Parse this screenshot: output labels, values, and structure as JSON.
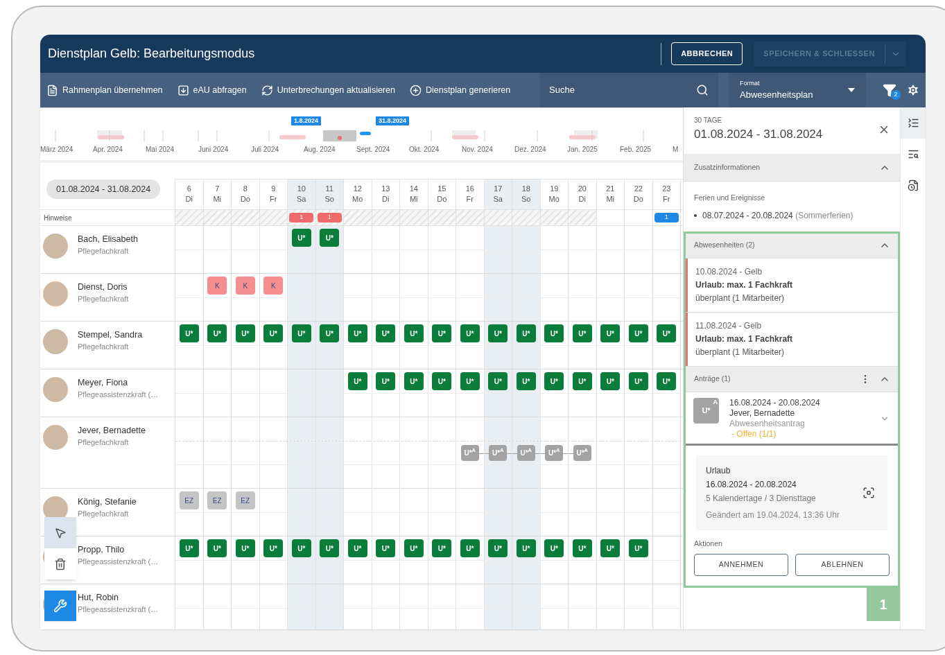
{
  "window": {
    "title": "Dienstplan Gelb: Bearbeitungsmodus"
  },
  "header_buttons": [
    {
      "label": "ABBRECHEN",
      "disabled": false
    },
    {
      "label": "SPEICHERN & SCHLIESSEN",
      "disabled": true
    }
  ],
  "toolbar": {
    "actions": [
      {
        "label": "Rahmenplan übernehmen",
        "kind": "template"
      },
      {
        "label": "eAU abfragen",
        "kind": "download"
      },
      {
        "label": "Unterbrechungen aktualisieren",
        "kind": "refresh"
      },
      {
        "label": "Dienstplan generieren",
        "kind": "generate"
      }
    ],
    "search": {
      "placeholder": "Suche"
    },
    "format": {
      "label": "Format",
      "value": "Abwesenheitsplan"
    },
    "filter_badge": "2"
  },
  "timeline": {
    "months": [
      "März 2024",
      "Apr. 2024",
      "Mai 2024",
      "Juni 2024",
      "Juli 2024",
      "Aug. 2024",
      "Sept. 2024",
      "Okt. 2024",
      "Nov. 2024",
      "Dez. 2024",
      "Jan. 2025",
      "Feb. 2025",
      "M"
    ],
    "range_start": "1.8.2024",
    "range_end": "31.8.2024"
  },
  "grid": {
    "range": "01.08.2024 - 31.08.2024",
    "hints_label": "Hinweise",
    "days": [
      {
        "day": "6",
        "weekday": "Di",
        "weekend": false,
        "holiday": true
      },
      {
        "day": "7",
        "weekday": "Mi",
        "weekend": false,
        "holiday": true
      },
      {
        "day": "8",
        "weekday": "Do",
        "weekend": false,
        "holiday": true
      },
      {
        "day": "9",
        "weekday": "Fr",
        "weekend": false,
        "holiday": true
      },
      {
        "day": "10",
        "weekday": "Sa",
        "weekend": true,
        "holiday": true
      },
      {
        "day": "11",
        "weekday": "So",
        "weekend": true,
        "holiday": true
      },
      {
        "day": "12",
        "weekday": "Mo",
        "weekend": false,
        "holiday": true
      },
      {
        "day": "13",
        "weekday": "Di",
        "weekend": false,
        "holiday": true
      },
      {
        "day": "14",
        "weekday": "Mi",
        "weekend": false,
        "holiday": true
      },
      {
        "day": "15",
        "weekday": "Do",
        "weekend": false,
        "holiday": true
      },
      {
        "day": "16",
        "weekday": "Fr",
        "weekend": false,
        "holiday": true
      },
      {
        "day": "17",
        "weekday": "Sa",
        "weekend": true,
        "holiday": true
      },
      {
        "day": "18",
        "weekday": "So",
        "weekend": true,
        "holiday": true
      },
      {
        "day": "19",
        "weekday": "Mo",
        "weekend": false,
        "holiday": true
      },
      {
        "day": "20",
        "weekday": "Di",
        "weekend": false,
        "holiday": true
      },
      {
        "day": "21",
        "weekday": "Mi",
        "weekend": false,
        "holiday": false
      },
      {
        "day": "22",
        "weekday": "Do",
        "weekend": false,
        "holiday": false
      },
      {
        "day": "23",
        "weekday": "Fr",
        "weekend": false,
        "holiday": false
      }
    ],
    "hints": [
      {
        "kind": "empty"
      },
      {
        "kind": "empty"
      },
      {
        "kind": "empty"
      },
      {
        "kind": "empty"
      },
      {
        "kind": "warning",
        "count": "1"
      },
      {
        "kind": "warning",
        "count": "1"
      },
      {
        "kind": "empty"
      },
      {
        "kind": "empty"
      },
      {
        "kind": "empty"
      },
      {
        "kind": "empty"
      },
      {
        "kind": "empty"
      },
      {
        "kind": "empty"
      },
      {
        "kind": "empty"
      },
      {
        "kind": "empty"
      },
      {
        "kind": "empty"
      },
      {
        "kind": "empty"
      },
      {
        "kind": "empty"
      },
      {
        "kind": "info",
        "count": "1"
      }
    ],
    "employees": [
      {
        "name": "Bach, Elisabeth",
        "role": "Pflegefachkraft",
        "lanes": [
          [
            {
              "kind": "empty"
            },
            {
              "kind": "empty"
            },
            {
              "kind": "empty"
            },
            {
              "kind": "empty"
            },
            {
              "kind": "vacation",
              "code": "U*"
            },
            {
              "kind": "vacation",
              "code": "U*"
            },
            {
              "kind": "empty"
            },
            {
              "kind": "empty"
            },
            {
              "kind": "empty"
            },
            {
              "kind": "empty"
            },
            {
              "kind": "empty"
            },
            {
              "kind": "empty"
            },
            {
              "kind": "empty"
            },
            {
              "kind": "empty"
            },
            {
              "kind": "empty"
            },
            {
              "kind": "empty"
            },
            {
              "kind": "empty"
            },
            {
              "kind": "empty"
            }
          ]
        ]
      },
      {
        "name": "Dienst, Doris",
        "role": "Pflegefachkraft",
        "lanes": [
          [
            {
              "kind": "empty"
            },
            {
              "kind": "sick",
              "code": "K"
            },
            {
              "kind": "sick",
              "code": "K"
            },
            {
              "kind": "sick",
              "code": "K"
            },
            {
              "kind": "empty"
            },
            {
              "kind": "empty"
            },
            {
              "kind": "empty"
            },
            {
              "kind": "empty"
            },
            {
              "kind": "empty"
            },
            {
              "kind": "empty"
            },
            {
              "kind": "empty"
            },
            {
              "kind": "empty"
            },
            {
              "kind": "empty"
            },
            {
              "kind": "empty"
            },
            {
              "kind": "empty"
            },
            {
              "kind": "empty"
            },
            {
              "kind": "empty"
            },
            {
              "kind": "empty"
            }
          ]
        ]
      },
      {
        "name": "Stempel, Sandra",
        "role": "Pflegefachkraft",
        "lanes": [
          [
            {
              "kind": "vacation",
              "code": "U*"
            },
            {
              "kind": "vacation",
              "code": "U*"
            },
            {
              "kind": "vacation",
              "code": "U*"
            },
            {
              "kind": "vacation",
              "code": "U*"
            },
            {
              "kind": "vacation",
              "code": "U*"
            },
            {
              "kind": "vacation",
              "code": "U*"
            },
            {
              "kind": "vacation",
              "code": "U*"
            },
            {
              "kind": "vacation",
              "code": "U*"
            },
            {
              "kind": "vacation",
              "code": "U*"
            },
            {
              "kind": "vacation",
              "code": "U*"
            },
            {
              "kind": "vacation",
              "code": "U*"
            },
            {
              "kind": "vacation",
              "code": "U*"
            },
            {
              "kind": "vacation",
              "code": "U*"
            },
            {
              "kind": "vacation",
              "code": "U*"
            },
            {
              "kind": "vacation",
              "code": "U*"
            },
            {
              "kind": "vacation",
              "code": "U*"
            },
            {
              "kind": "vacation",
              "code": "U*"
            },
            {
              "kind": "vacation",
              "code": "U*"
            }
          ]
        ]
      },
      {
        "name": "Meyer, Fiona",
        "role": "Pflegeassistenzkraft (…",
        "lanes": [
          [
            {
              "kind": "empty"
            },
            {
              "kind": "empty"
            },
            {
              "kind": "empty"
            },
            {
              "kind": "empty"
            },
            {
              "kind": "empty"
            },
            {
              "kind": "empty"
            },
            {
              "kind": "vacation",
              "code": "U*"
            },
            {
              "kind": "vacation",
              "code": "U*"
            },
            {
              "kind": "vacation",
              "code": "U*"
            },
            {
              "kind": "vacation",
              "code": "U*"
            },
            {
              "kind": "vacation",
              "code": "U*"
            },
            {
              "kind": "vacation",
              "code": "U*"
            },
            {
              "kind": "vacation",
              "code": "U*"
            },
            {
              "kind": "vacation",
              "code": "U*"
            },
            {
              "kind": "vacation",
              "code": "U*"
            },
            {
              "kind": "vacation",
              "code": "U*"
            },
            {
              "kind": "vacation",
              "code": "U*"
            },
            {
              "kind": "vacation",
              "code": "U*"
            }
          ]
        ]
      },
      {
        "name": "Jever, Bernadette",
        "role": "Pflegefachkraft",
        "lanes": [
          [
            {
              "kind": "empty"
            },
            {
              "kind": "empty"
            },
            {
              "kind": "empty"
            },
            {
              "kind": "empty"
            },
            {
              "kind": "empty"
            },
            {
              "kind": "empty"
            },
            {
              "kind": "empty"
            },
            {
              "kind": "empty"
            },
            {
              "kind": "empty"
            },
            {
              "kind": "empty"
            },
            {
              "kind": "empty"
            },
            {
              "kind": "empty"
            },
            {
              "kind": "empty"
            },
            {
              "kind": "empty"
            },
            {
              "kind": "empty"
            },
            {
              "kind": "empty"
            },
            {
              "kind": "empty"
            },
            {
              "kind": "empty"
            }
          ],
          [
            {
              "kind": "empty"
            },
            {
              "kind": "empty"
            },
            {
              "kind": "empty"
            },
            {
              "kind": "empty"
            },
            {
              "kind": "empty"
            },
            {
              "kind": "empty"
            },
            {
              "kind": "empty"
            },
            {
              "kind": "empty"
            },
            {
              "kind": "empty"
            },
            {
              "kind": "empty"
            },
            {
              "kind": "request",
              "code": "U*$^{A}$"
            },
            {
              "kind": "request",
              "code": "U*$^{A}$"
            },
            {
              "kind": "request",
              "code": "U*$^{A}$"
            },
            {
              "kind": "request",
              "code": "U*$^{A}$"
            },
            {
              "kind": "request",
              "code": "U*$^{A}$"
            },
            {
              "kind": "empty"
            },
            {
              "kind": "empty"
            },
            {
              "kind": "empty"
            }
          ]
        ]
      },
      {
        "name": "König, Stefanie",
        "role": "Pflegefachkraft",
        "lanes": [
          [
            {
              "kind": "timeoff",
              "code": "EZ"
            },
            {
              "kind": "timeoff",
              "code": "EZ"
            },
            {
              "kind": "timeoff",
              "code": "EZ"
            },
            {
              "kind": "empty"
            },
            {
              "kind": "empty"
            },
            {
              "kind": "empty"
            },
            {
              "kind": "empty"
            },
            {
              "kind": "empty"
            },
            {
              "kind": "empty"
            },
            {
              "kind": "empty"
            },
            {
              "kind": "empty"
            },
            {
              "kind": "empty"
            },
            {
              "kind": "empty"
            },
            {
              "kind": "empty"
            },
            {
              "kind": "empty"
            },
            {
              "kind": "empty"
            },
            {
              "kind": "empty"
            },
            {
              "kind": "empty"
            }
          ]
        ]
      },
      {
        "name": "Propp, Thilo",
        "role": "Pflegeassistenzkraft (…",
        "lanes": [
          [
            {
              "kind": "vacation",
              "code": "U*"
            },
            {
              "kind": "vacation",
              "code": "U*"
            },
            {
              "kind": "vacation",
              "code": "U*"
            },
            {
              "kind": "vacation",
              "code": "U*"
            },
            {
              "kind": "vacation",
              "code": "U*"
            },
            {
              "kind": "vacation",
              "code": "U*"
            },
            {
              "kind": "vacation",
              "code": "U*"
            },
            {
              "kind": "vacation",
              "code": "U*"
            },
            {
              "kind": "vacation",
              "code": "U*"
            },
            {
              "kind": "vacation",
              "code": "U*"
            },
            {
              "kind": "vacation",
              "code": "U*"
            },
            {
              "kind": "vacation",
              "code": "U*"
            },
            {
              "kind": "vacation",
              "code": "U*"
            },
            {
              "kind": "vacation",
              "code": "U*"
            },
            {
              "kind": "vacation",
              "code": "U*"
            },
            {
              "kind": "vacation",
              "code": "U*"
            },
            {
              "kind": "vacation",
              "code": "U*"
            },
            {
              "kind": "empty"
            }
          ]
        ]
      },
      {
        "name": "Hut, Robin",
        "role": "Pflegeassistenzkraft (…",
        "lanes": [
          [
            {
              "kind": "empty"
            },
            {
              "kind": "empty"
            },
            {
              "kind": "empty"
            },
            {
              "kind": "empty"
            },
            {
              "kind": "empty"
            },
            {
              "kind": "empty"
            },
            {
              "kind": "empty"
            },
            {
              "kind": "empty"
            },
            {
              "kind": "empty"
            },
            {
              "kind": "empty"
            },
            {
              "kind": "empty"
            },
            {
              "kind": "empty"
            },
            {
              "kind": "empty"
            },
            {
              "kind": "empty"
            },
            {
              "kind": "empty"
            },
            {
              "kind": "empty"
            },
            {
              "kind": "empty"
            },
            {
              "kind": "empty"
            }
          ]
        ]
      }
    ]
  },
  "palette": {
    "tools": [
      {
        "kind": "pointer",
        "selected": true
      },
      {
        "kind": "delete",
        "selected": false
      }
    ]
  },
  "panel": {
    "count": "30 TAGE",
    "range": "01.08.2024 - 31.08.2024",
    "info": {
      "title": "Zusatzinformationen",
      "expanded": true,
      "subtitle": "Ferien und Ereignisse",
      "events": [
        {
          "dates": "08.07.2024 - 20.08.2024",
          "note": "(Sommerferien)"
        }
      ]
    },
    "absences": {
      "title": "Abwesenheiten (2)",
      "expanded": true,
      "items": [
        {
          "date": "10.08.2024 - Gelb",
          "rule": "Urlaub: max. 1 Fachkraft",
          "status": "überplant (1 Mitarbeiter)",
          "color": "#e57373"
        },
        {
          "date": "11.08.2024 - Gelb",
          "rule": "Urlaub: max. 1 Fachkraft",
          "status": "überplant (1 Mitarbeiter)",
          "color": "#e57373"
        }
      ]
    },
    "requests": {
      "title": "Anträge (1)",
      "expanded": true,
      "items": [
        {
          "badge": "U*",
          "badge_sup": "A",
          "dates": "16.08.2024 - 20.08.2024",
          "name": "Jever, Bernadette",
          "type": "Abwesenheitsantrag",
          "status": "- Offen (1/1)",
          "expanded": true,
          "detail": {
            "title": "Urlaub",
            "dates": "16.08.2024 - 20.08.2024",
            "days": "5 Kalendertage / 3 Diensttage",
            "changed": "Geändert am 19.04.2024, 13:36 Uhr"
          }
        }
      ],
      "actions_label": "Aktionen",
      "actions": [
        "ANNEHMEN",
        "ABLEHNEN"
      ]
    },
    "highlight": {
      "label": "1"
    }
  },
  "rail": [
    {
      "kind": "details",
      "selected": true
    },
    {
      "kind": "search",
      "selected": false
    },
    {
      "kind": "history",
      "selected": false
    }
  ]
}
